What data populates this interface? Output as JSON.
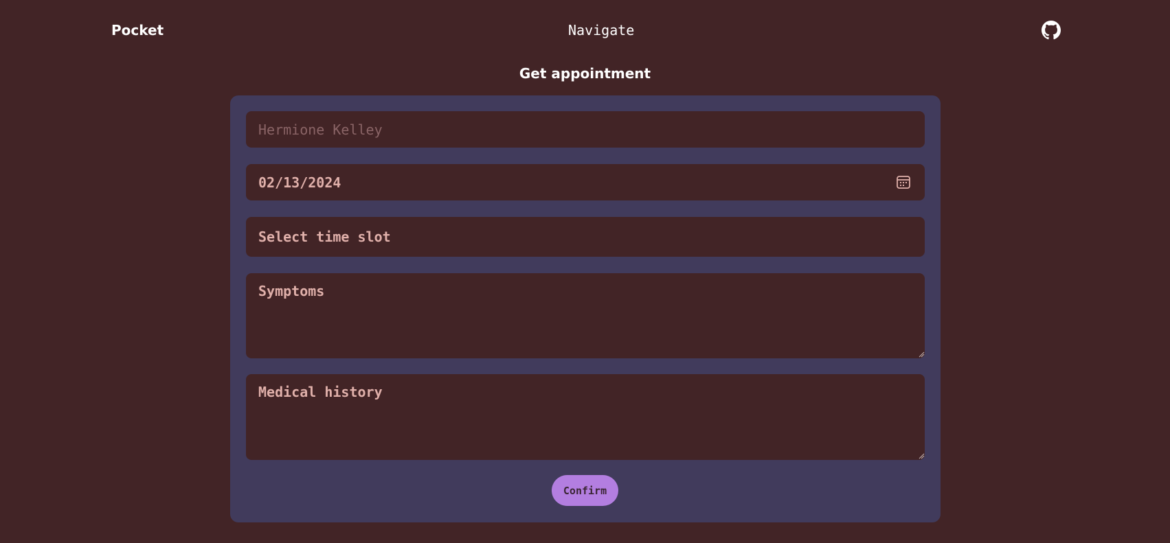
{
  "header": {
    "brand": "Pocket",
    "nav_link": "Navigate",
    "github_icon": "github-icon"
  },
  "page": {
    "title": "Get appointment"
  },
  "form": {
    "name_placeholder": "Hermione Kelley",
    "name_value": "",
    "date_value": "02/13/2024",
    "time_slot_label": "Select time slot",
    "symptoms_placeholder": "Symptoms",
    "medical_history_placeholder": "Medical history",
    "confirm_label": "Confirm"
  },
  "colors": {
    "background": "#422426",
    "card": "#413b5c",
    "accent": "#b37ee0",
    "field_text": "#e0b0aa"
  }
}
